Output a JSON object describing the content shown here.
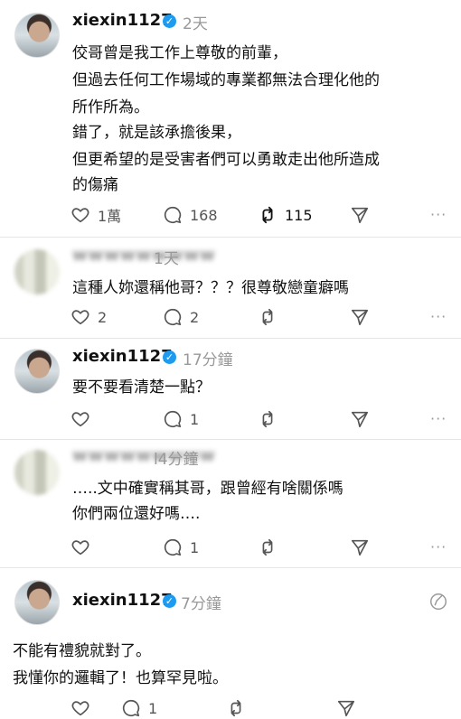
{
  "posts": [
    {
      "username": "xiexin1127",
      "verified": true,
      "time": "2天",
      "lines": [
        "佼哥曾是我工作上尊敬的前輩，",
        "但過去任何工作場域的專業都無法合理化他的",
        "所作所為。",
        "錯了，就是該承擔後果，",
        "但更希望的是受害者們可以勇敢走出他所造成",
        "的傷痛"
      ],
      "likes": "1萬",
      "comments": "168",
      "reposts": "115",
      "more": "···"
    },
    {
      "username": "wwwwwwwww",
      "verified": false,
      "time": "1天",
      "lines": [
        "這種人妳還稱他哥？？？很尊敬戀童癖嗎"
      ],
      "likes": "2",
      "comments": "2",
      "more": "···"
    },
    {
      "username": "xiexin1127",
      "verified": true,
      "time": "17分鐘",
      "lines": [
        "要不要看清楚一點？"
      ],
      "comments": "1",
      "more": "···"
    },
    {
      "username": "wwwwwwwww",
      "verified": false,
      "time": "l4分鐘",
      "lines": [
        "…..文中確實稱其哥，跟曾經有啥關係嗎",
        "你們兩位還好嗎…."
      ],
      "comments": "1",
      "more": "···"
    },
    {
      "username": "xiexin1127",
      "verified": true,
      "time": "7分鐘",
      "lines": [
        "不能有禮貌就對了。",
        "我懂你的邏輯了！也算罕見啦。"
      ],
      "comments": "1"
    }
  ],
  "icons": {
    "like": "heart-icon",
    "comment": "comment-bubble-icon",
    "repost": "repost-icon",
    "share": "send-icon",
    "verified": "verified-check-icon",
    "edit": "edit-icon"
  },
  "colors": {
    "verified": "#1d9bf0",
    "muted": "#999999",
    "text": "#111111"
  }
}
